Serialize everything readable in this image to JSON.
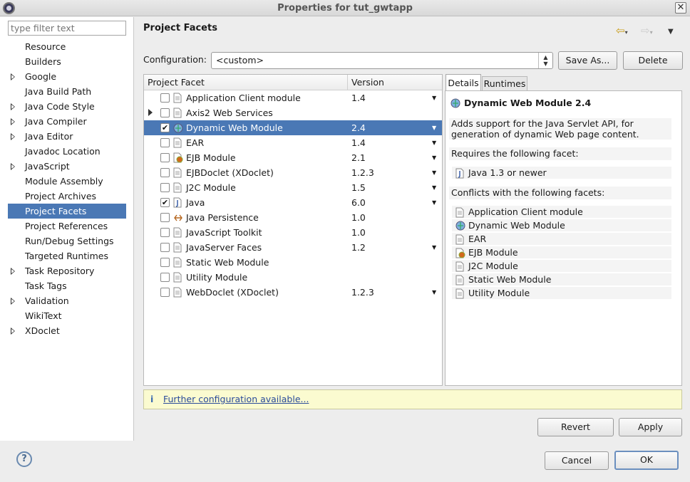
{
  "window": {
    "title": "Properties for tut_gwtapp"
  },
  "filter": {
    "placeholder": "type filter text"
  },
  "nav": [
    {
      "label": "Resource",
      "expandable": false,
      "selected": false
    },
    {
      "label": "Builders",
      "expandable": false,
      "selected": false
    },
    {
      "label": "Google",
      "expandable": true,
      "selected": false
    },
    {
      "label": "Java Build Path",
      "expandable": false,
      "selected": false
    },
    {
      "label": "Java Code Style",
      "expandable": true,
      "selected": false
    },
    {
      "label": "Java Compiler",
      "expandable": true,
      "selected": false
    },
    {
      "label": "Java Editor",
      "expandable": true,
      "selected": false
    },
    {
      "label": "Javadoc Location",
      "expandable": false,
      "selected": false
    },
    {
      "label": "JavaScript",
      "expandable": true,
      "selected": false
    },
    {
      "label": "Module Assembly",
      "expandable": false,
      "selected": false
    },
    {
      "label": "Project Archives",
      "expandable": false,
      "selected": false
    },
    {
      "label": "Project Facets",
      "expandable": false,
      "selected": true
    },
    {
      "label": "Project References",
      "expandable": false,
      "selected": false
    },
    {
      "label": "Run/Debug Settings",
      "expandable": false,
      "selected": false
    },
    {
      "label": "Targeted Runtimes",
      "expandable": false,
      "selected": false
    },
    {
      "label": "Task Repository",
      "expandable": true,
      "selected": false
    },
    {
      "label": "Task Tags",
      "expandable": false,
      "selected": false
    },
    {
      "label": "Validation",
      "expandable": true,
      "selected": false
    },
    {
      "label": "WikiText",
      "expandable": false,
      "selected": false
    },
    {
      "label": "XDoclet",
      "expandable": true,
      "selected": false
    }
  ],
  "page": {
    "heading": "Project Facets"
  },
  "configuration": {
    "label": "Configuration:",
    "value": "<custom>",
    "save_as": "Save As...",
    "delete": "Delete"
  },
  "facets": {
    "col_facet": "Project Facet",
    "col_version": "Version",
    "rows": [
      {
        "name": "Application Client module",
        "version": "1.4",
        "checked": false,
        "dropdown": true,
        "expandable": false,
        "selected": false,
        "icon": "page-icon"
      },
      {
        "name": "Axis2 Web Services",
        "version": "",
        "checked": false,
        "dropdown": false,
        "expandable": true,
        "selected": false,
        "icon": "page-icon"
      },
      {
        "name": "Dynamic Web Module",
        "version": "2.4",
        "checked": true,
        "dropdown": true,
        "expandable": false,
        "selected": true,
        "icon": "globe-icon"
      },
      {
        "name": "EAR",
        "version": "1.4",
        "checked": false,
        "dropdown": true,
        "expandable": false,
        "selected": false,
        "icon": "page-icon"
      },
      {
        "name": "EJB Module",
        "version": "2.1",
        "checked": false,
        "dropdown": true,
        "expandable": false,
        "selected": false,
        "icon": "bean-icon"
      },
      {
        "name": "EJBDoclet (XDoclet)",
        "version": "1.2.3",
        "checked": false,
        "dropdown": true,
        "expandable": false,
        "selected": false,
        "icon": "page-icon"
      },
      {
        "name": "J2C Module",
        "version": "1.5",
        "checked": false,
        "dropdown": true,
        "expandable": false,
        "selected": false,
        "icon": "page-icon"
      },
      {
        "name": "Java",
        "version": "6.0",
        "checked": true,
        "dropdown": true,
        "expandable": false,
        "selected": false,
        "icon": "java-icon"
      },
      {
        "name": "Java Persistence",
        "version": "1.0",
        "checked": false,
        "dropdown": false,
        "expandable": false,
        "selected": false,
        "icon": "persistence-icon"
      },
      {
        "name": "JavaScript Toolkit",
        "version": "1.0",
        "checked": false,
        "dropdown": false,
        "expandable": false,
        "selected": false,
        "icon": "page-icon"
      },
      {
        "name": "JavaServer Faces",
        "version": "1.2",
        "checked": false,
        "dropdown": true,
        "expandable": false,
        "selected": false,
        "icon": "page-icon"
      },
      {
        "name": "Static Web Module",
        "version": "",
        "checked": false,
        "dropdown": false,
        "expandable": false,
        "selected": false,
        "icon": "page-icon"
      },
      {
        "name": "Utility Module",
        "version": "",
        "checked": false,
        "dropdown": false,
        "expandable": false,
        "selected": false,
        "icon": "page-icon"
      },
      {
        "name": "WebDoclet (XDoclet)",
        "version": "1.2.3",
        "checked": false,
        "dropdown": true,
        "expandable": false,
        "selected": false,
        "icon": "page-icon"
      }
    ]
  },
  "details": {
    "tab_details": "Details",
    "tab_runtimes": "Runtimes",
    "title": "Dynamic Web Module 2.4",
    "description": "Adds support for the Java Servlet API, for generation of dynamic Web page content.",
    "requires_label": "Requires the following facet:",
    "requires": [
      {
        "name": "Java 1.3 or newer",
        "icon": "java-icon"
      }
    ],
    "conflicts_label": "Conflicts with the following facets:",
    "conflicts": [
      {
        "name": "Application Client module",
        "icon": "page-icon"
      },
      {
        "name": "Dynamic Web Module",
        "icon": "globe-icon"
      },
      {
        "name": "EAR",
        "icon": "page-icon"
      },
      {
        "name": "EJB Module",
        "icon": "bean-icon"
      },
      {
        "name": "J2C Module",
        "icon": "page-icon"
      },
      {
        "name": "Static Web Module",
        "icon": "page-icon"
      },
      {
        "name": "Utility Module",
        "icon": "page-icon"
      }
    ]
  },
  "info": {
    "icon": "i",
    "link": "Further configuration available..."
  },
  "buttons": {
    "revert": "Revert",
    "apply": "Apply",
    "cancel": "Cancel",
    "ok": "OK"
  },
  "help": {
    "glyph": "?"
  },
  "colors": {
    "selection": "#4a78b5",
    "info_bg": "#fbfbd0",
    "link": "#2a4b9a"
  }
}
